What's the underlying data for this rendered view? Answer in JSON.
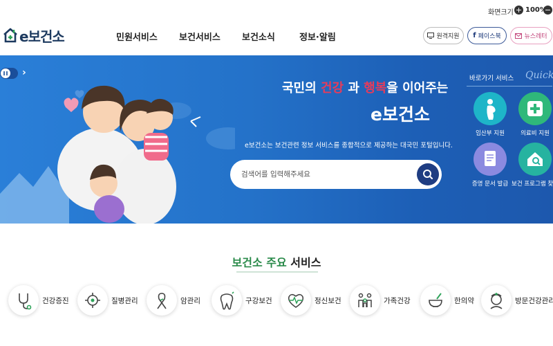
{
  "util": {
    "zoom_label": "화면크기",
    "zoom_in": "+",
    "zoom_value": "100%",
    "zoom_out": "−"
  },
  "header": {
    "logo_text": "e보건소",
    "nav": [
      "민원서비스",
      "보건서비스",
      "보건소식",
      "정보·알림"
    ],
    "buttons": {
      "remote": "원격지원",
      "facebook": "페이스북",
      "newsletter": "뉴스레터"
    }
  },
  "hero": {
    "tagline": {
      "p1": "국민의 ",
      "p2": "건강",
      "p3": " 과 ",
      "p4": "행복",
      "p5": "을 이어주는"
    },
    "brand": "e보건소",
    "description": "e보건소는 보건관련 정보 서비스를 종합적으로 제공하는 대국민 포털입니다.",
    "search_placeholder": "검색어를 입력해주세요",
    "quick": {
      "title": "바로가기 서비스",
      "script": "Quick",
      "items": [
        "임산부 지원",
        "의료비 지원",
        "증명 문서 발급",
        "보건 프로그램 찾기"
      ]
    }
  },
  "section": {
    "title_green": "보건소 주요",
    "title_rest": " 서비스",
    "services": [
      "건강증진",
      "질병관리",
      "암관리",
      "구강보건",
      "정신보건",
      "가족건강",
      "한의약",
      "방문건강관리"
    ]
  },
  "colors": {
    "hero_blue": "#2472c9",
    "navy": "#1f3d82",
    "green": "#2a8a4a",
    "quick_teal": "#1eb5a8",
    "quick_green": "#2fb87a",
    "quick_lavender": "#8b8ae0",
    "quick_seafoam": "#26b3a0"
  }
}
